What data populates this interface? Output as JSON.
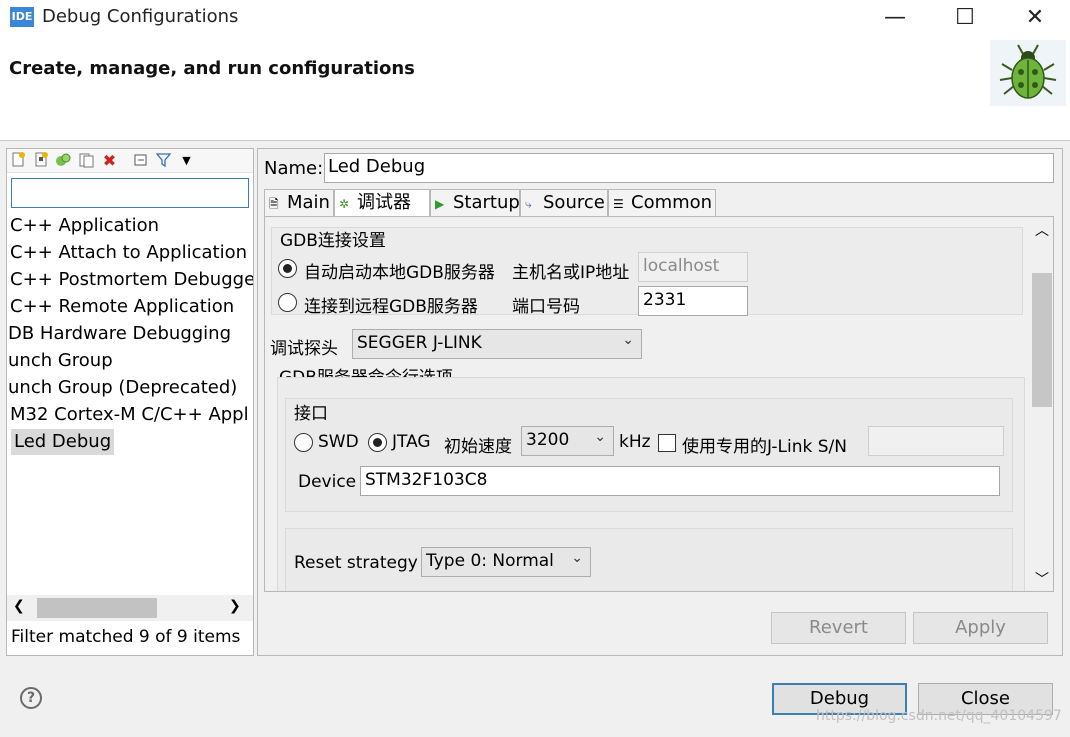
{
  "window": {
    "badge": "IDE",
    "title": "Debug Configurations",
    "minimize": "—",
    "maximize": "☐",
    "close": "✕"
  },
  "header": {
    "title": "Create, manage, and run configurations",
    "icon": "bug-icon"
  },
  "left_panel": {
    "toolbar_icons": [
      "new-config-icon",
      "new-prototype-icon",
      "duplicate-icon",
      "export-icon",
      "delete-icon",
      "collapse-all-icon",
      "filter-icon",
      "view-menu-icon"
    ],
    "filter_placeholder": "",
    "items": [
      "C++ Application",
      "C++ Attach to Application",
      "C++ Postmortem Debugger",
      "C++ Remote Application",
      "DB Hardware Debugging",
      "unch Group",
      "unch Group (Deprecated)",
      "M32 Cortex-M C/C++ Appl",
      "Led Debug"
    ],
    "selected_item": "Led Debug",
    "filter_status": "Filter matched 9 of 9 items"
  },
  "right_panel": {
    "name_label": "Name:",
    "name_value": "Led Debug",
    "tabs": [
      {
        "label": "Main",
        "icon": "main-tab-icon"
      },
      {
        "label": "调试器",
        "icon": "debugger-tab-icon"
      },
      {
        "label": "Startup",
        "icon": "startup-tab-icon"
      },
      {
        "label": "Source",
        "icon": "source-tab-icon"
      },
      {
        "label": "Common",
        "icon": "common-tab-icon"
      }
    ],
    "active_tab": "调试器",
    "gdb_connection": {
      "title": "GDB连接设置",
      "auto_start_label": "自动启动本地GDB服务器",
      "auto_start_selected": true,
      "host_label": "主机名或IP地址",
      "host_value": "localhost",
      "remote_label": "连接到远程GDB服务器",
      "remote_selected": false,
      "port_label": "端口号码",
      "port_value": "2331"
    },
    "probe": {
      "label": "调试探头",
      "value": "SEGGER J-LINK"
    },
    "gdb_server_options": {
      "title": "GDB服务器命令行选项",
      "interface": {
        "title": "接口",
        "swd_label": "SWD",
        "swd_selected": false,
        "jtag_label": "JTAG",
        "jtag_selected": true,
        "speed_label": "初始速度",
        "speed_value": "3200",
        "speed_unit": "kHz",
        "sn_label": "使用专用的J-Link S/N",
        "sn_checked": false,
        "sn_value": "",
        "device_label": "Device",
        "device_value": "STM32F103C8"
      },
      "reset_label": "Reset strategy",
      "reset_value": "Type 0: Normal"
    },
    "revert_label": "Revert",
    "apply_label": "Apply"
  },
  "footer": {
    "help": "?",
    "debug_label": "Debug",
    "close_label": "Close",
    "watermark": "https://blog.csdn.net/qq_40104597"
  }
}
